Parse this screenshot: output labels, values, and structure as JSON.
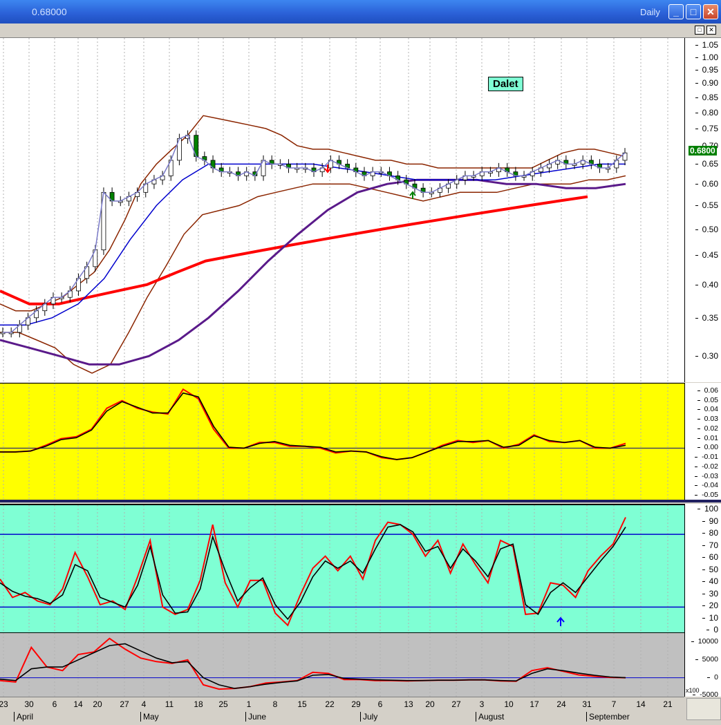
{
  "window": {
    "value": "0.68000",
    "period": "Daily",
    "minimize": "_",
    "maximize": "□",
    "close": "✕",
    "inner_restore": "□",
    "inner_close": "✕"
  },
  "label_box": "Dalet",
  "last_price": "0.6800",
  "multiplier": "x100",
  "colors": {
    "price_bg": "#ffffff",
    "macd_bg": "#ffff00",
    "stoch_bg": "#7fffd4",
    "vol_bg": "#c0c0c0",
    "bollinger": "#8b2500",
    "ma_fast": "#0000cd",
    "ma_mid": "#5a1a8a",
    "ma_slow": "#ff0000",
    "signal": "#000000",
    "oscillator": "#ff0000"
  },
  "chart_data": [
    {
      "type": "candlestick",
      "title": "Dalet",
      "y_scale": "log",
      "ylim": [
        0.27,
        1.08
      ],
      "yticks": [
        "1.05",
        "1.00",
        "0.95",
        "0.90",
        "0.85",
        "0.80",
        "0.75",
        "0.70",
        "0.65",
        "0.60",
        "0.55",
        "0.50",
        "0.45",
        "0.40",
        "0.35",
        "0.30"
      ],
      "close": [
        0.33,
        0.33,
        0.34,
        0.35,
        0.36,
        0.37,
        0.38,
        0.38,
        0.39,
        0.41,
        0.43,
        0.46,
        0.58,
        0.56,
        0.56,
        0.57,
        0.58,
        0.6,
        0.61,
        0.62,
        0.66,
        0.72,
        0.73,
        0.67,
        0.66,
        0.64,
        0.63,
        0.63,
        0.62,
        0.63,
        0.62,
        0.66,
        0.65,
        0.65,
        0.64,
        0.64,
        0.64,
        0.63,
        0.64,
        0.66,
        0.65,
        0.64,
        0.63,
        0.62,
        0.63,
        0.63,
        0.62,
        0.61,
        0.6,
        0.59,
        0.58,
        0.58,
        0.59,
        0.6,
        0.61,
        0.62,
        0.62,
        0.63,
        0.63,
        0.64,
        0.63,
        0.62,
        0.62,
        0.63,
        0.64,
        0.65,
        0.66,
        0.65,
        0.65,
        0.66,
        0.65,
        0.64,
        0.64,
        0.66,
        0.68
      ],
      "bollinger_upper": [
        0.37,
        0.36,
        0.36,
        0.37,
        0.38,
        0.4,
        0.42,
        0.46,
        0.52,
        0.6,
        0.65,
        0.69,
        0.73,
        0.79,
        0.78,
        0.77,
        0.76,
        0.75,
        0.73,
        0.7,
        0.69,
        0.69,
        0.68,
        0.67,
        0.66,
        0.66,
        0.65,
        0.65,
        0.64,
        0.64,
        0.64,
        0.64,
        0.64,
        0.64,
        0.64,
        0.66,
        0.68,
        0.69,
        0.69,
        0.68,
        0.67
      ],
      "bollinger_lower": [
        0.33,
        0.33,
        0.32,
        0.31,
        0.29,
        0.28,
        0.29,
        0.33,
        0.38,
        0.43,
        0.49,
        0.53,
        0.54,
        0.55,
        0.57,
        0.58,
        0.59,
        0.6,
        0.6,
        0.6,
        0.59,
        0.58,
        0.57,
        0.56,
        0.57,
        0.58,
        0.58,
        0.58,
        0.59,
        0.6,
        0.6,
        0.6,
        0.61,
        0.61,
        0.62
      ],
      "ma_slow": [
        0.39,
        0.37,
        0.37,
        0.38,
        0.39,
        0.4,
        0.42,
        0.44,
        0.45,
        0.46,
        0.47,
        0.48,
        0.49,
        0.5,
        0.51,
        0.52,
        0.53,
        0.54,
        0.55,
        0.56,
        0.57
      ],
      "ma_mid": [
        0.32,
        0.31,
        0.3,
        0.29,
        0.29,
        0.3,
        0.32,
        0.35,
        0.39,
        0.44,
        0.49,
        0.54,
        0.58,
        0.6,
        0.61,
        0.61,
        0.61,
        0.6,
        0.6,
        0.59,
        0.59,
        0.6
      ],
      "ma_fast": [
        0.34,
        0.34,
        0.35,
        0.37,
        0.41,
        0.48,
        0.55,
        0.61,
        0.65,
        0.65,
        0.65,
        0.65,
        0.65,
        0.64,
        0.63,
        0.62,
        0.61,
        0.61,
        0.61,
        0.61,
        0.62,
        0.63,
        0.64,
        0.65,
        0.65
      ]
    },
    {
      "type": "line",
      "title": "",
      "ylim": [
        -0.055,
        0.068
      ],
      "yticks": [
        "0.06",
        "0.05",
        "0.04",
        "0.03",
        "0.02",
        "0.01",
        "0.00",
        "-0.01",
        "-0.02",
        "-0.03",
        "-0.04",
        "-0.05"
      ],
      "series": [
        {
          "values": [
            -0.004,
            -0.004,
            -0.003,
            0.003,
            0.01,
            0.012,
            0.02,
            0.042,
            0.05,
            0.042,
            0.038,
            0.036,
            0.062,
            0.052,
            0.02,
            0.0,
            0.0,
            0.006,
            0.006,
            0.002,
            0.002,
            0.0,
            -0.005,
            -0.003,
            -0.004,
            -0.01,
            -0.012,
            -0.01,
            -0.004,
            0.003,
            0.008,
            0.006,
            0.008,
            0.0,
            0.004,
            0.014,
            0.007,
            0.006,
            0.008,
            0.0,
            0.0,
            0.005
          ]
        },
        {
          "values": [
            -0.004,
            -0.004,
            -0.003,
            0.002,
            0.009,
            0.011,
            0.019,
            0.039,
            0.049,
            0.043,
            0.037,
            0.037,
            0.058,
            0.054,
            0.023,
            0.001,
            0.0,
            0.005,
            0.007,
            0.003,
            0.002,
            0.001,
            -0.004,
            -0.003,
            -0.004,
            -0.009,
            -0.012,
            -0.01,
            -0.004,
            0.002,
            0.007,
            0.007,
            0.008,
            0.001,
            0.003,
            0.013,
            0.008,
            0.006,
            0.008,
            0.001,
            0.0,
            0.003
          ]
        }
      ]
    },
    {
      "type": "line",
      "title": "",
      "ylim": [
        -2,
        104
      ],
      "yticks": [
        "100",
        "90",
        "80",
        "70",
        "60",
        "50",
        "40",
        "30",
        "20",
        "10",
        "0"
      ],
      "reference_lines": [
        80,
        20
      ],
      "series": [
        {
          "values": [
            43,
            28,
            32,
            25,
            22,
            35,
            65,
            45,
            22,
            25,
            18,
            45,
            75,
            20,
            14,
            18,
            42,
            88,
            40,
            20,
            42,
            42,
            15,
            5,
            30,
            52,
            62,
            50,
            62,
            43,
            75,
            90,
            88,
            80,
            62,
            75,
            48,
            72,
            55,
            40,
            75,
            70,
            14,
            15,
            40,
            38,
            28,
            50,
            62,
            72,
            94
          ]
        },
        {
          "values": [
            40,
            33,
            29,
            27,
            23,
            30,
            55,
            50,
            28,
            24,
            20,
            38,
            70,
            30,
            15,
            16,
            35,
            78,
            50,
            25,
            36,
            44,
            22,
            10,
            24,
            45,
            58,
            52,
            58,
            48,
            68,
            86,
            88,
            82,
            66,
            70,
            52,
            68,
            58,
            45,
            68,
            72,
            22,
            14,
            32,
            40,
            32,
            45,
            58,
            70,
            86
          ]
        }
      ]
    },
    {
      "type": "line",
      "title": "",
      "ylim": [
        -5500,
        12500
      ],
      "yticks": [
        "10000",
        "5000",
        "0",
        "-5000"
      ],
      "series": [
        {
          "values": [
            -800,
            -1200,
            8500,
            3000,
            2000,
            6500,
            7200,
            11000,
            8000,
            5500,
            4500,
            4000,
            5000,
            -2000,
            -3200,
            -3000,
            -2500,
            -1500,
            -1200,
            -800,
            1500,
            1200,
            -500,
            -500,
            -800,
            -800,
            -900,
            -800,
            -700,
            -700,
            -600,
            -600,
            -900,
            -1000,
            2000,
            2800,
            1800,
            800,
            400,
            100,
            0
          ]
        },
        {
          "values": [
            -400,
            -800,
            2500,
            3000,
            3000,
            5000,
            7000,
            9000,
            9500,
            7500,
            5500,
            4200,
            4500,
            0,
            -2000,
            -3000,
            -2500,
            -1800,
            -1300,
            -900,
            700,
            900,
            -200,
            -400,
            -600,
            -700,
            -800,
            -800,
            -700,
            -700,
            -600,
            -600,
            -800,
            -900,
            1200,
            2500,
            2000,
            1300,
            700,
            200,
            0
          ]
        }
      ]
    },
    {
      "type": "date_axis",
      "days": [
        "23",
        "30",
        "6",
        "14",
        "20",
        "27",
        "4",
        "11",
        "18",
        "25",
        "1",
        "8",
        "15",
        "22",
        "29",
        "6",
        "13",
        "20",
        "27",
        "3",
        "10",
        "17",
        "24",
        "31",
        "7",
        "14",
        "21"
      ],
      "months": [
        "April",
        "May",
        "June",
        "July",
        "August",
        "September"
      ]
    }
  ]
}
